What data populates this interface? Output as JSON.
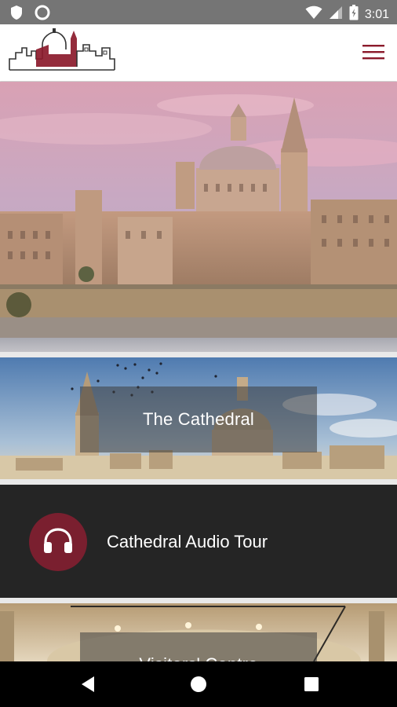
{
  "status_bar": {
    "time": "3:01",
    "left_icons": [
      "shield-icon",
      "circle-icon"
    ],
    "right_icons": [
      "wifi-icon",
      "signal-icon",
      "battery-icon"
    ]
  },
  "app_bar": {
    "logo": "cathedral-skyline-logo",
    "menu_icon": "hamburger-menu-icon",
    "accent_color": "#8b1a2b"
  },
  "hero": {
    "image": "valletta-skyline-photo"
  },
  "cards": {
    "cathedral": {
      "title": "The Cathedral",
      "image": "cathedral-dome-photo"
    },
    "audio_tour": {
      "title": "Cathedral Audio Tour",
      "icon": "headphones-icon",
      "icon_bg": "#7a1f2f"
    },
    "visitors": {
      "title": "Visitors' Centre",
      "image": "vaulted-hall-photo"
    }
  },
  "nav_bar": {
    "buttons": [
      "back-icon",
      "home-icon",
      "recents-icon"
    ]
  }
}
